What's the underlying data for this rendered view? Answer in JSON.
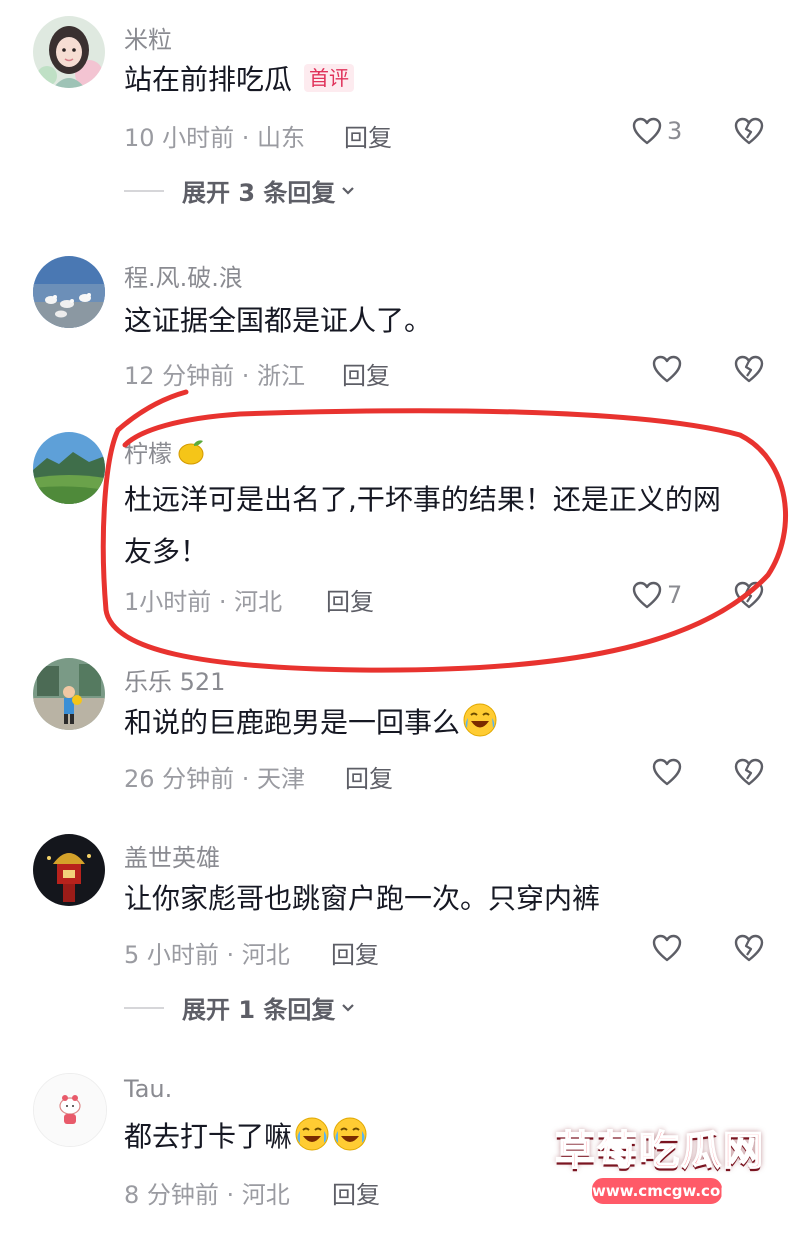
{
  "comments": [
    {
      "username": "米粒",
      "text": "站在前排吃瓜",
      "badge": "首评",
      "meta": "10 小时前 · 山东",
      "reply_label": "回复",
      "likes": "3",
      "expand_label": "展开 3 条回复"
    },
    {
      "username": "程.风.破.浪",
      "text": "这证据全国都是证人了。",
      "meta": "12 分钟前 · 浙江",
      "reply_label": "回复"
    },
    {
      "username": "柠檬",
      "username_icon": "lemon-emoji",
      "text_line1": "杜远洋可是出名了,干坏事的结果！还是正义的网",
      "text_line2": "友多！",
      "meta": "1小时前 · 河北",
      "reply_label": "回复",
      "likes": "7",
      "highlighted": true
    },
    {
      "username": "乐乐 521",
      "text": "和说的巨鹿跑男是一回事么",
      "text_emoji": "rofl-emoji",
      "meta": "26 分钟前 · 天津",
      "reply_label": "回复"
    },
    {
      "username": "盖世英雄",
      "text": "让你家彪哥也跳窗户跑一次。只穿内裤",
      "meta": "5 小时前 · 河北",
      "reply_label": "回复",
      "expand_label": "展开 1 条回复"
    },
    {
      "username": "Tau.",
      "text": "都去打卡了嘛",
      "text_emoji": "joy-emoji",
      "meta": "8 分钟前 · 河北",
      "reply_label": "回复"
    }
  ],
  "watermark": {
    "title": "草莓吃瓜网",
    "url": "www.cmcgw.com"
  },
  "colors": {
    "annotation_circle": "#e8332f",
    "badge_text": "#e0325a",
    "secondary_text": "#8a8b91"
  }
}
